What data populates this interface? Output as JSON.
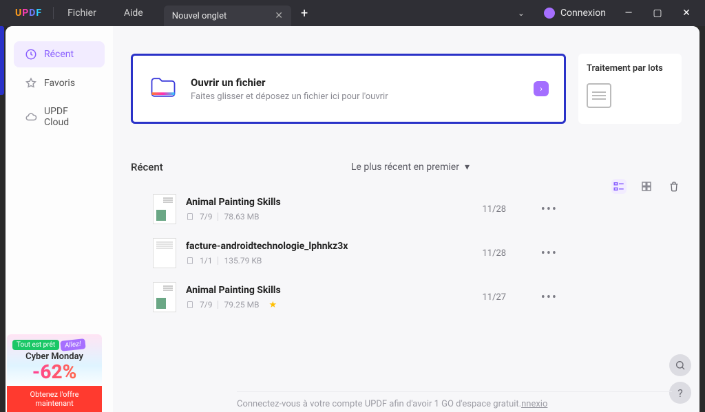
{
  "titlebar": {
    "logo_chars": [
      "U",
      "P",
      "D",
      "F"
    ],
    "menu": {
      "file": "Fichier",
      "help": "Aide"
    },
    "tab": {
      "label": "Nouvel onglet"
    },
    "login": "Connexion"
  },
  "sidebar": {
    "items": [
      {
        "label": "Récent",
        "icon": "clock-icon",
        "active": true
      },
      {
        "label": "Favoris",
        "icon": "star-icon",
        "active": false
      },
      {
        "label": "UPDF Cloud",
        "icon": "cloud-icon",
        "active": false
      }
    ]
  },
  "open_file": {
    "title": "Ouvrir un fichier",
    "subtitle": "Faites glisser et déposez un fichier ici pour l'ouvrir"
  },
  "batch": {
    "title": "Traitement par lots"
  },
  "recent": {
    "title": "Récent",
    "sort_label": "Le plus récent en premier",
    "files": [
      {
        "name": "Animal Painting Skills",
        "pages": "7/9",
        "size": "78.63 MB",
        "date": "11/28",
        "starred": false,
        "thumb": "doc"
      },
      {
        "name": "facture-androidtechnologie_lphnkz3x",
        "pages": "1/1",
        "size": "135.79 KB",
        "date": "11/28",
        "starred": false,
        "thumb": "invoice"
      },
      {
        "name": "Animal Painting Skills",
        "pages": "7/9",
        "size": "79.25 MB",
        "date": "11/27",
        "starred": true,
        "thumb": "doc"
      }
    ]
  },
  "footer": {
    "msg": "Connectez-vous à votre compte UPDF afin d'avoir 1 GO d'espace gratuit.",
    "link": "nnexio"
  },
  "promo": {
    "pill1": "Tout est prêt",
    "pill2": "Allez!",
    "line1": "Cyber Monday",
    "discount": "-62%",
    "cta1": "Obtenez l'offre",
    "cta2": "maintenant"
  }
}
